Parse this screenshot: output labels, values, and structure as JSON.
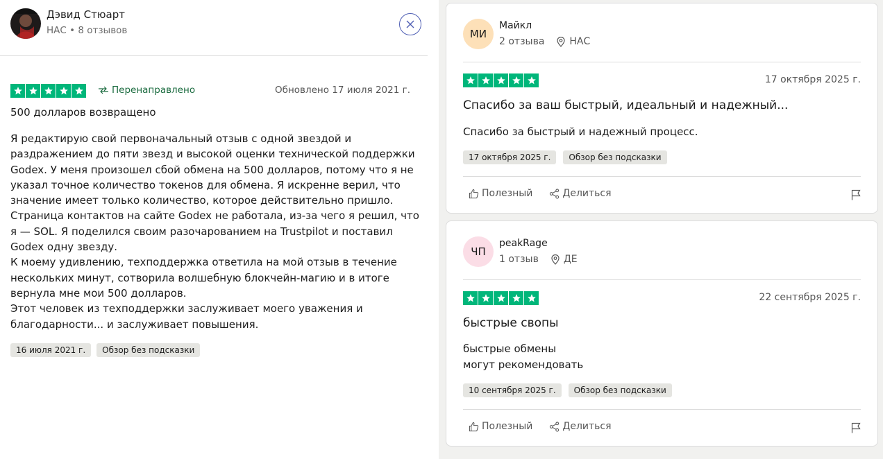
{
  "left_review": {
    "author": {
      "name": "Дэвид Стюарт",
      "meta": "НАС • 8 отзывов"
    },
    "rating": 5,
    "redirected_label": "Перенаправлено",
    "updated_label": "Обновлено 17 июля 2021 г.",
    "title": "500 долларов возвращено",
    "body_lines": [
      "Я редактирую свой первоначальный отзыв с одной звездой и раздражением до пяти звезд и высокой оценки технической поддержки Godex. У меня произошел сбой обмена на 500 долларов, потому что я не указал точное количество токенов для обмена. Я искренне верил, что значение имеет только количество, которое действительно пришло. Страница контактов на сайте Godex не работала, из-за чего я решил, что я — SOL. Я поделился своим разочарованием на Trustpilot и поставил Godex одну звезду.",
      "К моему удивлению, техподдержка ответила на мой отзыв в течение нескольких минут, сотворила волшебную блокчейн-магию и в итоге вернула мне мои 500 долларов.",
      "Этот человек из техподдержки заслуживает моего уважения и благодарности... и заслуживает повышения."
    ],
    "tags": [
      "16 июля 2021 г.",
      "Обзор без подсказки"
    ]
  },
  "cards": [
    {
      "initials": "МИ",
      "avatar_color": "#fde0b8",
      "name": "Майкл",
      "review_count": "2 отзыва",
      "location": "НАС",
      "rating": 5,
      "date": "17 октября 2025 г.",
      "title": "Спасибо за ваш быстрый, идеальный и надежный...",
      "body_lines": [
        "Спасибо за быстрый и надежный процесс."
      ],
      "tags": [
        "17 октября 2025 г.",
        "Обзор без подсказки"
      ],
      "useful_label": "Полезный",
      "share_label": "Делиться"
    },
    {
      "initials": "ЧП",
      "avatar_color": "#fbdde6",
      "name": "peakRage",
      "review_count": "1 отзыв",
      "location": "ДЕ",
      "rating": 5,
      "date": "22 сентября 2025 г.",
      "title": "быстрые свопы",
      "body_lines": [
        "быстрые обмены",
        "могут рекомендовать"
      ],
      "tags": [
        "10 сентября 2025 г.",
        "Обзор без подсказки"
      ],
      "useful_label": "Полезный",
      "share_label": "Делиться"
    }
  ],
  "colors": {
    "star_green": "#00b67a",
    "redirect_green": "#1c6c40",
    "close_blue": "#4f5fb4"
  },
  "icons": {
    "close": "close-icon",
    "redirect": "redirect-arrow-icon",
    "location": "location-pin-icon",
    "useful": "thumbs-up-icon",
    "share": "share-icon",
    "flag": "flag-icon",
    "star": "star-icon"
  }
}
